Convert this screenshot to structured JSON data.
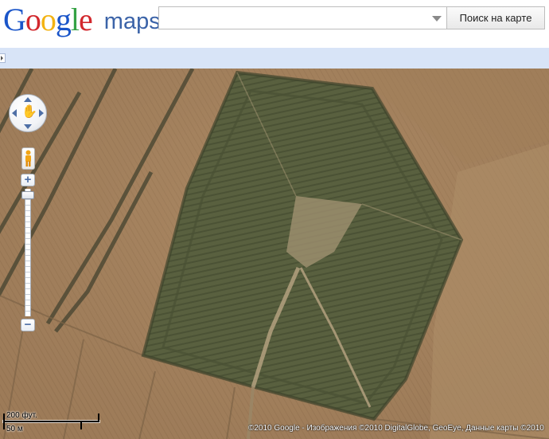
{
  "app": {
    "logo_google": [
      "G",
      "o",
      "o",
      "g",
      "l",
      "e"
    ],
    "logo_colors": [
      "#1a55c9",
      "#d2282d",
      "#f3b312",
      "#1a55c9",
      "#35a245",
      "#d2282d"
    ],
    "logo_maps": "maps"
  },
  "search": {
    "value": "",
    "placeholder": "",
    "button_label": "Поиск на карте"
  },
  "map_controls": {
    "pan_icon": "hand-icon",
    "pegman_icon": "street-view-pegman-icon",
    "zoom_in_label": "+",
    "zoom_out_label": "−",
    "zoom_level_fraction": 0.02
  },
  "scale": {
    "imperial_label": "200 фут.",
    "metric_label": "50 м"
  },
  "attribution": "©2010 Google - Изображения ©2010 DigitalGlobe, GeoEye, Данные карты ©2010",
  "imagery": {
    "field_color": "#a7845f",
    "forest_color": "#59603f",
    "road_color": "#bca687"
  }
}
